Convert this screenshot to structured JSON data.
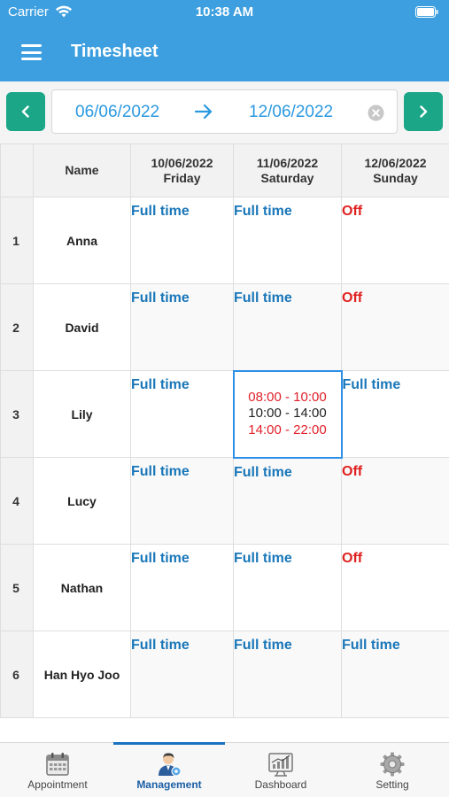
{
  "status_bar": {
    "carrier": "Carrier",
    "time": "10:38 AM"
  },
  "nav": {
    "title": "Timesheet",
    "menu_icon": "hamburger-menu-icon"
  },
  "date_range": {
    "from": "06/06/2022",
    "to": "12/06/2022",
    "prev_icon": "chevron-left-icon",
    "next_icon": "chevron-right-icon",
    "arrow_icon": "arrow-right-icon",
    "clear_icon": "clear-icon"
  },
  "table": {
    "headers": {
      "name": "Name",
      "days": [
        {
          "date": "10/06/2022",
          "day": "Friday"
        },
        {
          "date": "11/06/2022",
          "day": "Saturday"
        },
        {
          "date": "12/06/2022",
          "day": "Sunday"
        }
      ]
    },
    "rows": [
      {
        "index": "1",
        "name": "Anna",
        "cells": [
          "Full time",
          "Full time",
          "Off"
        ]
      },
      {
        "index": "2",
        "name": "David",
        "cells": [
          "Full time",
          "Full time",
          "Off"
        ]
      },
      {
        "index": "3",
        "name": "Lily",
        "cells": [
          "Full time",
          "",
          "Full time"
        ],
        "detail": [
          "08:00 - 10:00",
          "10:00 - 14:00",
          "14:00 - 22:00"
        ]
      },
      {
        "index": "4",
        "name": "Lucy",
        "cells": [
          "Full time",
          "Full time",
          "Off"
        ]
      },
      {
        "index": "5",
        "name": "Nathan",
        "cells": [
          "Full time",
          "Full time",
          "Off"
        ]
      },
      {
        "index": "6",
        "name": "Han Hyo Joo",
        "cells": [
          "Full time",
          "Full time",
          "Full time"
        ]
      }
    ]
  },
  "tabs": [
    {
      "label": "Appointment",
      "icon": "calendar-icon"
    },
    {
      "label": "Management",
      "icon": "user-manager-icon",
      "active": true
    },
    {
      "label": "Dashboard",
      "icon": "chart-dashboard-icon"
    },
    {
      "label": "Setting",
      "icon": "gear-icon"
    }
  ],
  "colors": {
    "header": "#3d9fdf",
    "nav_button": "#1aa687",
    "full_time": "#1a77b9",
    "off": "#e02020",
    "active_tab": "#1b5fa5"
  }
}
